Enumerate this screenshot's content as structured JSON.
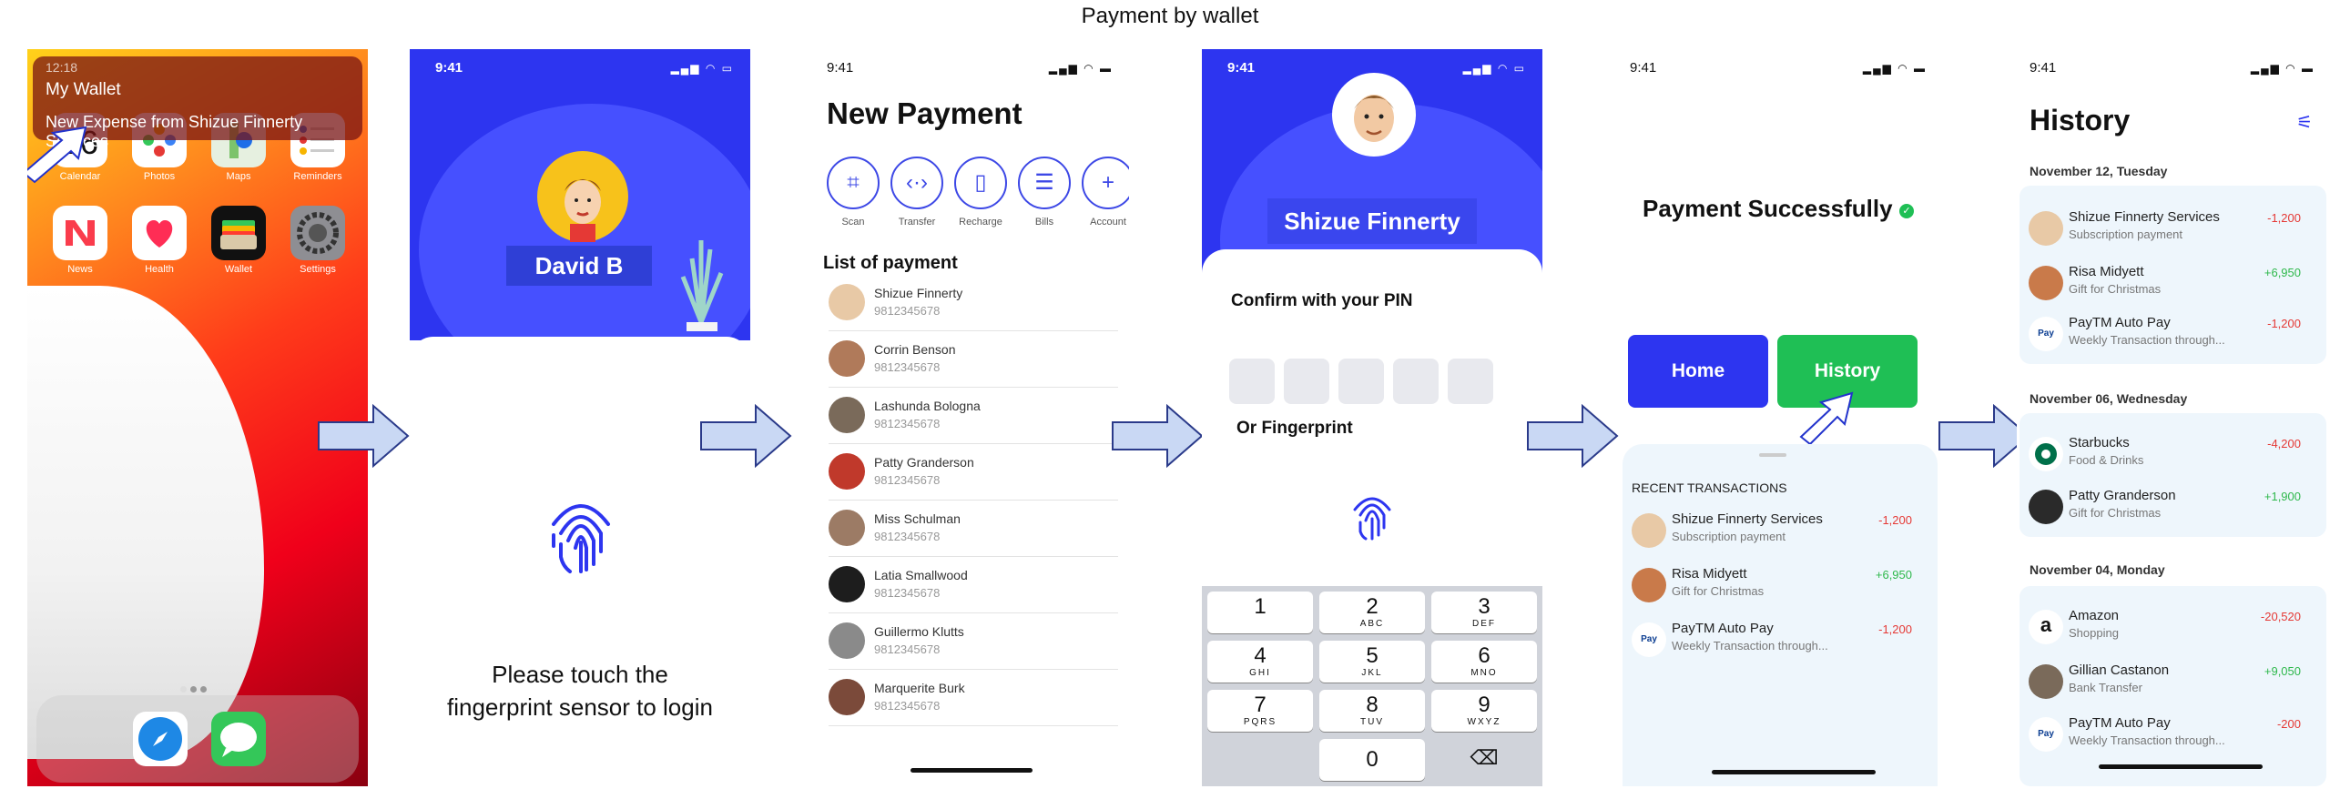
{
  "title": "Payment by wallet",
  "colors": {
    "blue": "#2d35f0",
    "green": "#1fbf55",
    "negative": "#e53935",
    "positive": "#2eb84b"
  },
  "screen1": {
    "notif_time": "12:18",
    "notif_app": "My Wallet",
    "notif_message": "New Expense from Shizue Finnerty Services",
    "calendar_day": "16",
    "apps": [
      "Calendar",
      "Photos",
      "Maps",
      "Reminders",
      "News",
      "Health",
      "Wallet",
      "Settings"
    ]
  },
  "screen2": {
    "time": "9:41",
    "user_name": "David B",
    "prompt_line1": "Please touch the",
    "prompt_line2": "fingerprint sensor to login"
  },
  "screen3": {
    "time": "9:41",
    "heading": "New Payment",
    "actions": [
      {
        "label": "Scan",
        "icon": "scan-icon"
      },
      {
        "label": "Transfer",
        "icon": "transfer-icon"
      },
      {
        "label": "Recharge",
        "icon": "phone-icon"
      },
      {
        "label": "Bills",
        "icon": "bill-icon"
      },
      {
        "label": "Account",
        "icon": "plus-icon"
      }
    ],
    "list_title": "List of payment",
    "contacts": [
      {
        "name": "Shizue Finnerty",
        "phone": "9812345678"
      },
      {
        "name": "Corrin Benson",
        "phone": "9812345678"
      },
      {
        "name": "Lashunda Bologna",
        "phone": "9812345678"
      },
      {
        "name": "Patty Granderson",
        "phone": "9812345678"
      },
      {
        "name": "Miss Schulman",
        "phone": "9812345678"
      },
      {
        "name": "Latia Smallwood",
        "phone": "9812345678"
      },
      {
        "name": "Guillermo Klutts",
        "phone": "9812345678"
      },
      {
        "name": "Marquerite Burk",
        "phone": "9812345678"
      }
    ]
  },
  "screen4": {
    "time": "9:41",
    "payee": "Shizue Finnerty",
    "pin_title": "Confirm with your PIN",
    "fingerprint_title": "Or Fingerprint",
    "keys": [
      {
        "d": "1",
        "l": ""
      },
      {
        "d": "2",
        "l": "ABC"
      },
      {
        "d": "3",
        "l": "DEF"
      },
      {
        "d": "4",
        "l": "GHI"
      },
      {
        "d": "5",
        "l": "JKL"
      },
      {
        "d": "6",
        "l": "MNO"
      },
      {
        "d": "7",
        "l": "PQRS"
      },
      {
        "d": "8",
        "l": "TUV"
      },
      {
        "d": "9",
        "l": "WXYZ"
      },
      {
        "d": "0",
        "l": ""
      }
    ]
  },
  "screen5": {
    "time": "9:41",
    "success": "Payment Successfully",
    "home_label": "Home",
    "history_label": "History",
    "recent_title": "RECENT TRANSACTIONS",
    "transactions": [
      {
        "name": "Shizue Finnerty Services",
        "desc": "Subscription payment",
        "amount": "-1,200"
      },
      {
        "name": "Risa Midyett",
        "desc": "Gift for Christmas",
        "amount": "+6,950"
      },
      {
        "name": "PayTM Auto Pay",
        "desc": "Weekly Transaction through...",
        "amount": "-1,200"
      }
    ]
  },
  "screen6": {
    "time": "9:41",
    "heading": "History",
    "groups": [
      {
        "date": "November 12, Tuesday",
        "items": [
          {
            "name": "Shizue Finnerty Services",
            "desc": "Subscription payment",
            "amount": "-1,200"
          },
          {
            "name": "Risa Midyett",
            "desc": "Gift for Christmas",
            "amount": "+6,950"
          },
          {
            "name": "PayTM Auto Pay",
            "desc": "Weekly Transaction through...",
            "amount": "-1,200"
          }
        ]
      },
      {
        "date": "November 06, Wednesday",
        "items": [
          {
            "name": "Starbucks",
            "desc": "Food & Drinks",
            "amount": "-4,200"
          },
          {
            "name": "Patty Granderson",
            "desc": "Gift for Christmas",
            "amount": "+1,900"
          }
        ]
      },
      {
        "date": "November 04, Monday",
        "items": [
          {
            "name": "Amazon",
            "desc": "Shopping",
            "amount": "-20,520"
          },
          {
            "name": "Gillian Castanon",
            "desc": "Bank Transfer",
            "amount": "+9,050"
          },
          {
            "name": "PayTM Auto Pay",
            "desc": "Weekly Transaction through...",
            "amount": "-200"
          }
        ]
      }
    ]
  }
}
